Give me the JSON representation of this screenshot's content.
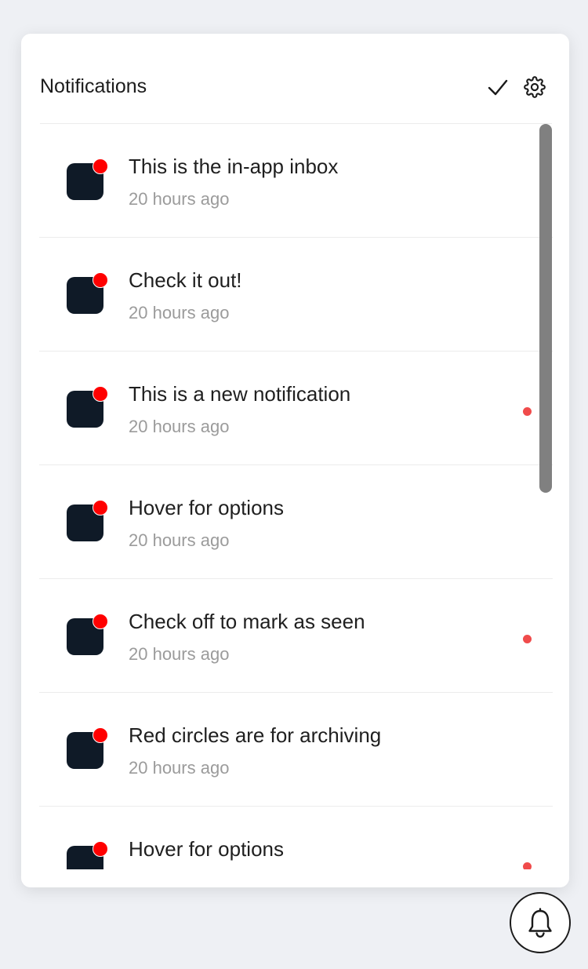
{
  "header": {
    "title": "Notifications",
    "mark_all_icon": "checkmark-icon",
    "settings_icon": "gear-icon"
  },
  "notifications": [
    {
      "message": "This is the in-app inbox",
      "time": "20 hours ago",
      "unread": false
    },
    {
      "message": "Check it out!",
      "time": "20 hours ago",
      "unread": false
    },
    {
      "message": "This is a new notification",
      "time": "20 hours ago",
      "unread": true
    },
    {
      "message": "Hover for options",
      "time": "20 hours ago",
      "unread": false
    },
    {
      "message": "Check off to mark as seen",
      "time": "20 hours ago",
      "unread": true
    },
    {
      "message": "Red circles are for archiving",
      "time": "20 hours ago",
      "unread": false
    },
    {
      "message": "Hover for options",
      "time": "",
      "unread": true
    }
  ],
  "bell_icon": "bell-icon",
  "colors": {
    "accent_red": "#ff0000",
    "unread_dot": "#f04b4b",
    "avatar": "#0f1a27"
  }
}
